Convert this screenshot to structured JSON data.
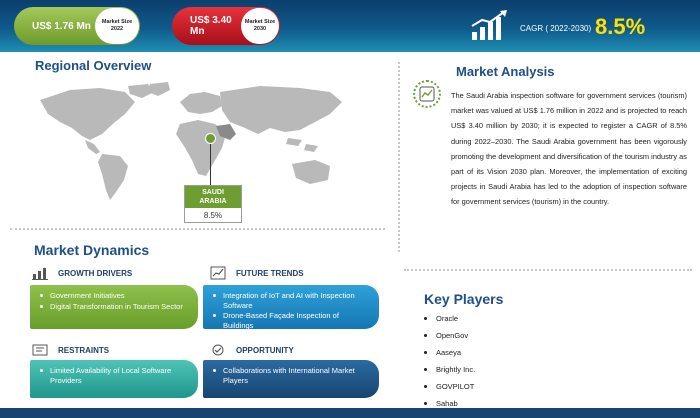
{
  "header": {
    "size_2022": {
      "value": "US$ 1.76 Mn",
      "badge_line1": "Market Size",
      "badge_line2": "2022"
    },
    "size_2030": {
      "value": "US$ 3.40 Mn",
      "badge_line1": "Market Size",
      "badge_line2": "2030"
    },
    "cagr_label": "CAGR ( 2022-2030)",
    "cagr_value": "8.5%",
    "colors": {
      "green": "#7aa83a",
      "red": "#c8161f",
      "navy": "#0b3f6e",
      "yellow": "#ffe100"
    }
  },
  "regional": {
    "title": "Regional Overview",
    "region_name_line1": "SAUDI",
    "region_name_line2": "ARABIA",
    "region_cagr": "8.5%"
  },
  "analysis": {
    "title": "Market Analysis",
    "icon": "chart-analysis-icon",
    "body": "The Saudi Arabia inspection software for government services (tourism) market was valued at US$ 1.76 million in 2022 and is projected to reach US$ 3.40 million by 2030; it is expected to register a CAGR of 8.5% during 2022–2030. The Saudi Arabia government has been vigorously promoting the development and diversification of the tourism industry as part of its Vision 2030 plan. Moreover, the implementation of exciting projects in Saudi Arabia has led to the adoption of inspection software for government services (tourism) in the country."
  },
  "players": {
    "title": "Key Players",
    "items": [
      "Oracle",
      "OpenGov",
      "Aaseya",
      "Brightly Inc.",
      "GOVPILOT",
      "Sahab"
    ]
  },
  "dynamics": {
    "title": "Market Dynamics",
    "growth": {
      "label": "GROWTH DRIVERS",
      "icon": "bar-growth-icon",
      "items": [
        "Government Initiatives",
        "Digital Transformation in Tourism Sector"
      ]
    },
    "trends": {
      "label": "FUTURE TRENDS",
      "icon": "trend-chart-icon",
      "items": [
        "Integration of IoT and AI with Inspection Software",
        "Drone-Based Façade Inspection of Buildings"
      ]
    },
    "restraints": {
      "label": "RESTRAINTS",
      "icon": "restraint-icon",
      "items": [
        "Limited Availability of Local Software Providers"
      ]
    },
    "opportunity": {
      "label": "OPPORTUNITY",
      "icon": "opportunity-icon",
      "items": [
        "Collaborations with International Market Players"
      ]
    }
  }
}
